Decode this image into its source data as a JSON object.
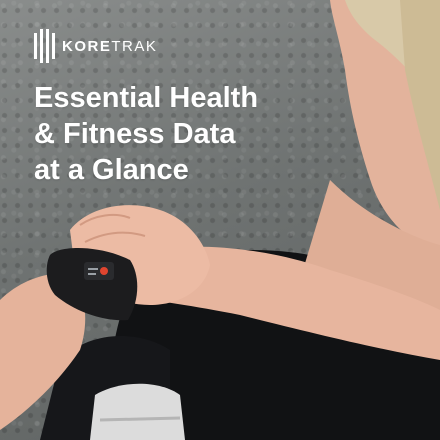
{
  "brand": {
    "name_bold": "KORE",
    "name_light": "TRAK"
  },
  "headline": {
    "line1": "Essential Health",
    "line2": "& Fitness Data",
    "line3": "at a Glance"
  },
  "colors": {
    "text": "#ffffff",
    "background": "#6f7372",
    "skin": "#e9b8a2",
    "band": "#1c1c1e",
    "hair": "#d6c7a6",
    "accent_red": "#e0452f"
  },
  "icons": {
    "logo": "koretrak-logo-icon"
  }
}
